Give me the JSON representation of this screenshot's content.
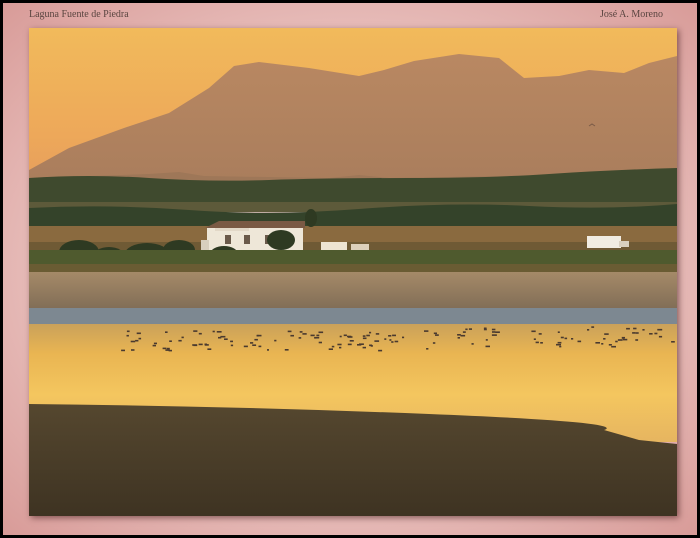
{
  "caption": {
    "location": "Laguna Fuente de Piedra",
    "author": "José A. Moreno"
  },
  "colors": {
    "frame": "#eac3c0",
    "sky_top": "#f0b75a",
    "sky_bottom": "#e8a158",
    "mountain": "#b0825d",
    "water_glow": "#f4c35c",
    "mudflat": "#4b3e2b"
  }
}
